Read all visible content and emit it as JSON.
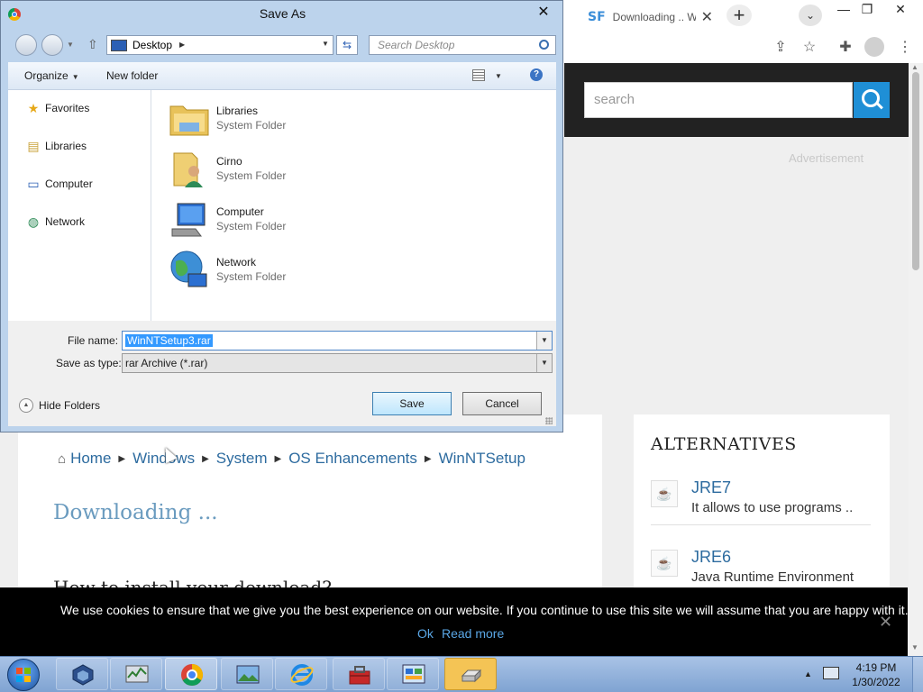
{
  "browser": {
    "tab": {
      "favicon_text": "SF",
      "title": "Downloading .. W",
      "close_glyph": "✕"
    },
    "new_tab_glyph": "+",
    "tab_search_glyph": "⌄",
    "window_controls": {
      "minimize": "—",
      "maximize": "❐",
      "close": "✕"
    },
    "toolbar_icons": [
      "share-icon",
      "star-icon",
      "extensions-icon",
      "profile-icon",
      "menu-icon"
    ],
    "toolbar_glyphs": {
      "share": "⇪",
      "star": "☆",
      "extensions": "✚",
      "menu": "⋮"
    }
  },
  "site": {
    "search_placeholder": "search",
    "advertisement_label": "Advertisement",
    "breadcrumb": [
      "Home",
      "Windows",
      "System",
      "OS Enhancements",
      "WinNTSetup"
    ],
    "page_heading": "Downloading ...",
    "install_heading": "How to install your download?",
    "alternatives": {
      "title": "ALTERNATIVES",
      "items": [
        {
          "name": "JRE7",
          "desc": "It allows to use programs .."
        },
        {
          "name": "JRE6",
          "desc": "Java Runtime Environment"
        }
      ]
    },
    "cookie": {
      "text": "We use cookies to ensure that we give you the best experience on our website. If you continue to use this site we will assume that you are happy with it.",
      "ok": "Ok",
      "read_more": "Read more",
      "close_glyph": "✕"
    }
  },
  "dialog": {
    "title": "Save As",
    "close_glyph": "✕",
    "address": "Desktop",
    "search_placeholder": "Search Desktop",
    "commands": {
      "organize": "Organize",
      "new_folder": "New folder"
    },
    "help_glyph": "?",
    "nav_items": [
      {
        "label": "Favorites",
        "icon": "star-icon",
        "glyph": "★"
      },
      {
        "label": "Libraries",
        "icon": "libraries-icon",
        "glyph": "▤"
      },
      {
        "label": "Computer",
        "icon": "computer-icon",
        "glyph": "▭"
      },
      {
        "label": "Network",
        "icon": "network-icon",
        "glyph": "◍"
      }
    ],
    "files": [
      {
        "name": "Libraries",
        "type": "System Folder",
        "icon": "libraries-folder-icon"
      },
      {
        "name": "Cirno",
        "type": "System Folder",
        "icon": "user-folder-icon"
      },
      {
        "name": "Computer",
        "type": "System Folder",
        "icon": "computer-icon"
      },
      {
        "name": "Network",
        "type": "System Folder",
        "icon": "network-globe-icon"
      }
    ],
    "file_name_label": "File name:",
    "file_name_value": "WinNTSetup3.rar",
    "save_type_label": "Save as type:",
    "save_type_value": "rar Archive (*.rar)",
    "hide_folders": "Hide Folders",
    "save_button": "Save",
    "cancel_button": "Cancel"
  },
  "taskbar": {
    "apps": [
      "virtualbox-icon",
      "task-manager-icon",
      "chrome-icon",
      "image-viewer-icon",
      "internet-explorer-icon",
      "toolbox-icon",
      "control-panel-icon",
      "drive-icon"
    ],
    "time": "4:19 PM",
    "date": "1/30/2022"
  },
  "colors": {
    "accent": "#1f8fd6",
    "link": "#2d6b9f",
    "dialog_frame": "#bcd3ec",
    "taskbar": "#8fb0dc"
  }
}
